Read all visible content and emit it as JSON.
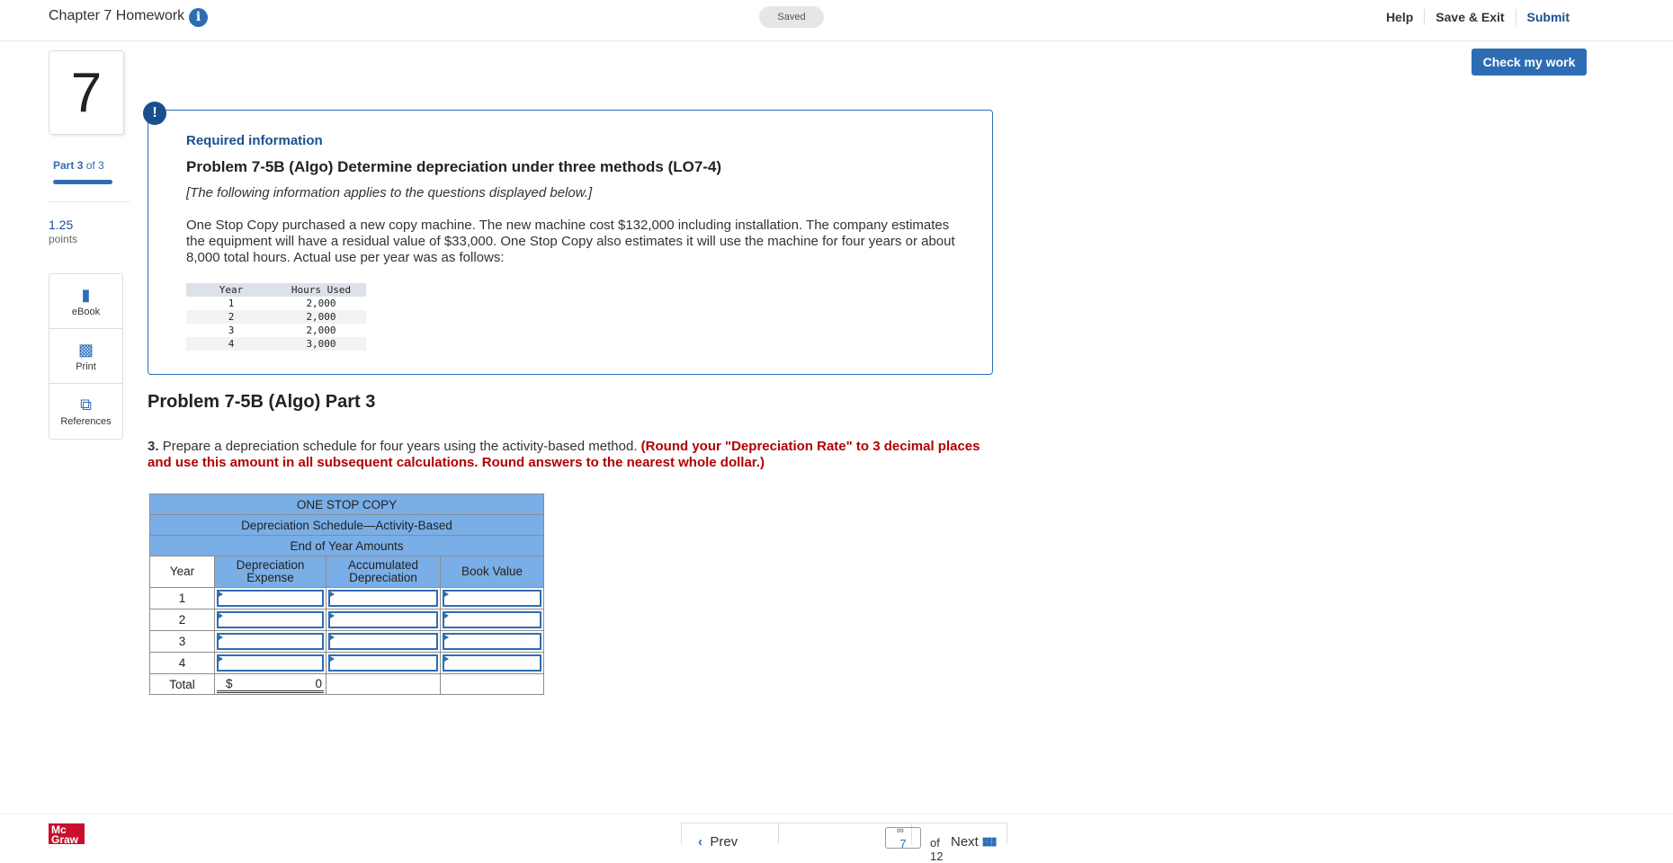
{
  "header": {
    "title": "Chapter 7 Homework",
    "status": "Saved",
    "help": "Help",
    "save_exit": "Save & Exit",
    "submit": "Submit",
    "check_work": "Check my work"
  },
  "sidebar": {
    "question_number": "7",
    "part_prefix": "Part",
    "part_current": "3",
    "part_suffix": "of 3",
    "progress_fraction": 1.0,
    "points_value": "1.25",
    "points_label": "points",
    "tools": [
      {
        "label": "eBook",
        "icon": "book-icon"
      },
      {
        "label": "Print",
        "icon": "printer-icon"
      },
      {
        "label": "References",
        "icon": "copy-icon"
      }
    ]
  },
  "required": {
    "heading": "Required information",
    "problem_title": "Problem 7-5B (Algo) Determine depreciation under three methods (LO7-4)",
    "note": "[The following information applies to the questions displayed below.]",
    "description": "One Stop Copy purchased a new copy machine. The new machine cost $132,000 including installation. The company estimates the equipment will have a residual value of $33,000. One Stop Copy also estimates it will use the machine for four years or about 8,000 total hours. Actual use per year was as follows:",
    "hours_table": {
      "headers": [
        "Year",
        "Hours Used"
      ],
      "rows": [
        [
          "1",
          "2,000"
        ],
        [
          "2",
          "2,000"
        ],
        [
          "3",
          "2,000"
        ],
        [
          "4",
          "3,000"
        ]
      ]
    }
  },
  "part": {
    "title": "Problem 7-5B (Algo) Part 3",
    "instruction_number": "3.",
    "instruction_text": "Prepare a depreciation schedule for four years using the activity-based method.",
    "instruction_red": "(Round your \"Depreciation Rate\" to 3 decimal places and use this amount in all subsequent calculations. Round answers to the nearest whole dollar.)"
  },
  "schedule": {
    "company": "ONE STOP COPY",
    "subtitle": "Depreciation Schedule—Activity-Based",
    "period": "End of Year Amounts",
    "columns": [
      "Year",
      "Depreciation Expense",
      "Accumulated Depreciation",
      "Book Value"
    ],
    "years": [
      "1",
      "2",
      "3",
      "4"
    ],
    "total_label": "Total",
    "total_currency": "$",
    "total_value": "0"
  },
  "footer": {
    "logo_line1": "Mc",
    "logo_line2": "Graw",
    "prev": "Prev",
    "page_current": "7",
    "page_of": "of 12",
    "next": "Next"
  }
}
